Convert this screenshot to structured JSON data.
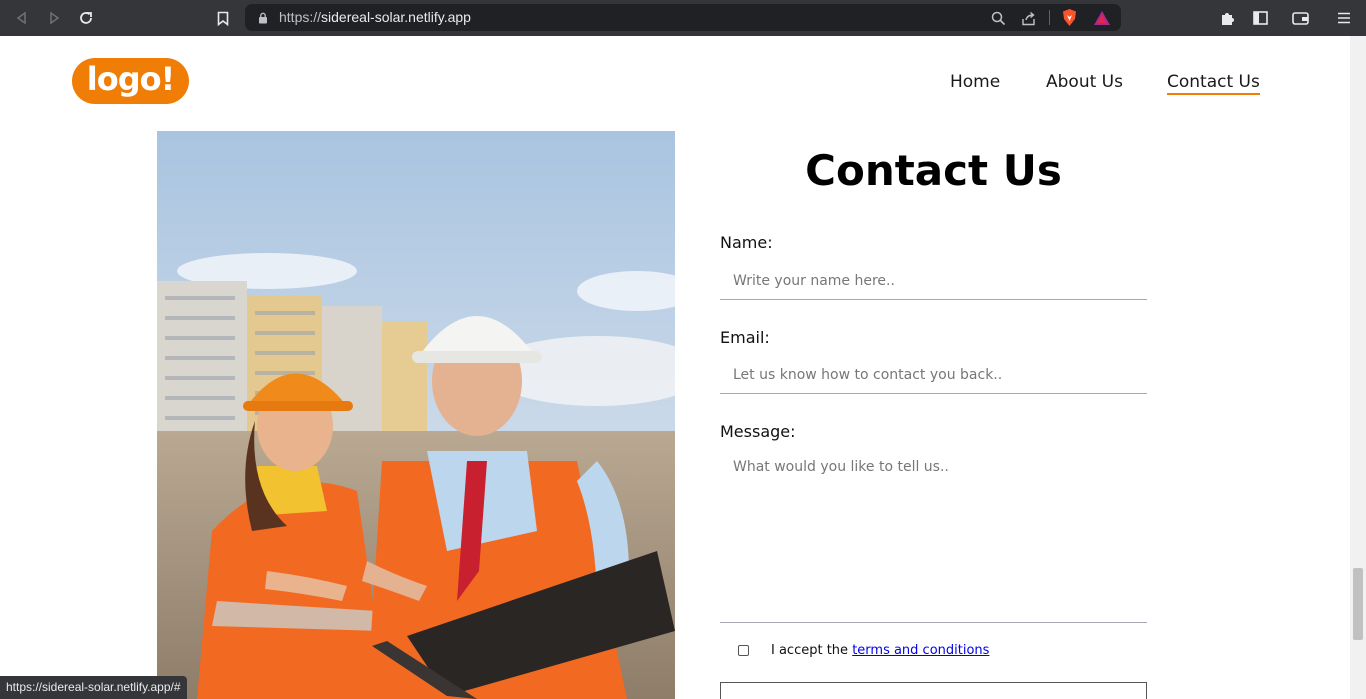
{
  "browser": {
    "url_prefix": "https://",
    "url_domain": "sidereal-solar.netlify.app",
    "status_url": "https://sidereal-solar.netlify.app/#"
  },
  "header": {
    "logo_text": "logo!",
    "nav": [
      "Home",
      "About Us",
      "Contact Us"
    ],
    "active_nav": "Contact Us",
    "accent_color": "#ef7d06"
  },
  "form": {
    "title": "Contact Us",
    "name_label": "Name:",
    "name_placeholder": "Write your name here..",
    "email_label": "Email:",
    "email_placeholder": "Let us know how to contact you back..",
    "message_label": "Message:",
    "message_placeholder": "What would you like to tell us..",
    "accept_text": "I accept the",
    "terms_link": "terms and conditions"
  },
  "photo": {
    "description_icon": "construction-workers-photo"
  }
}
